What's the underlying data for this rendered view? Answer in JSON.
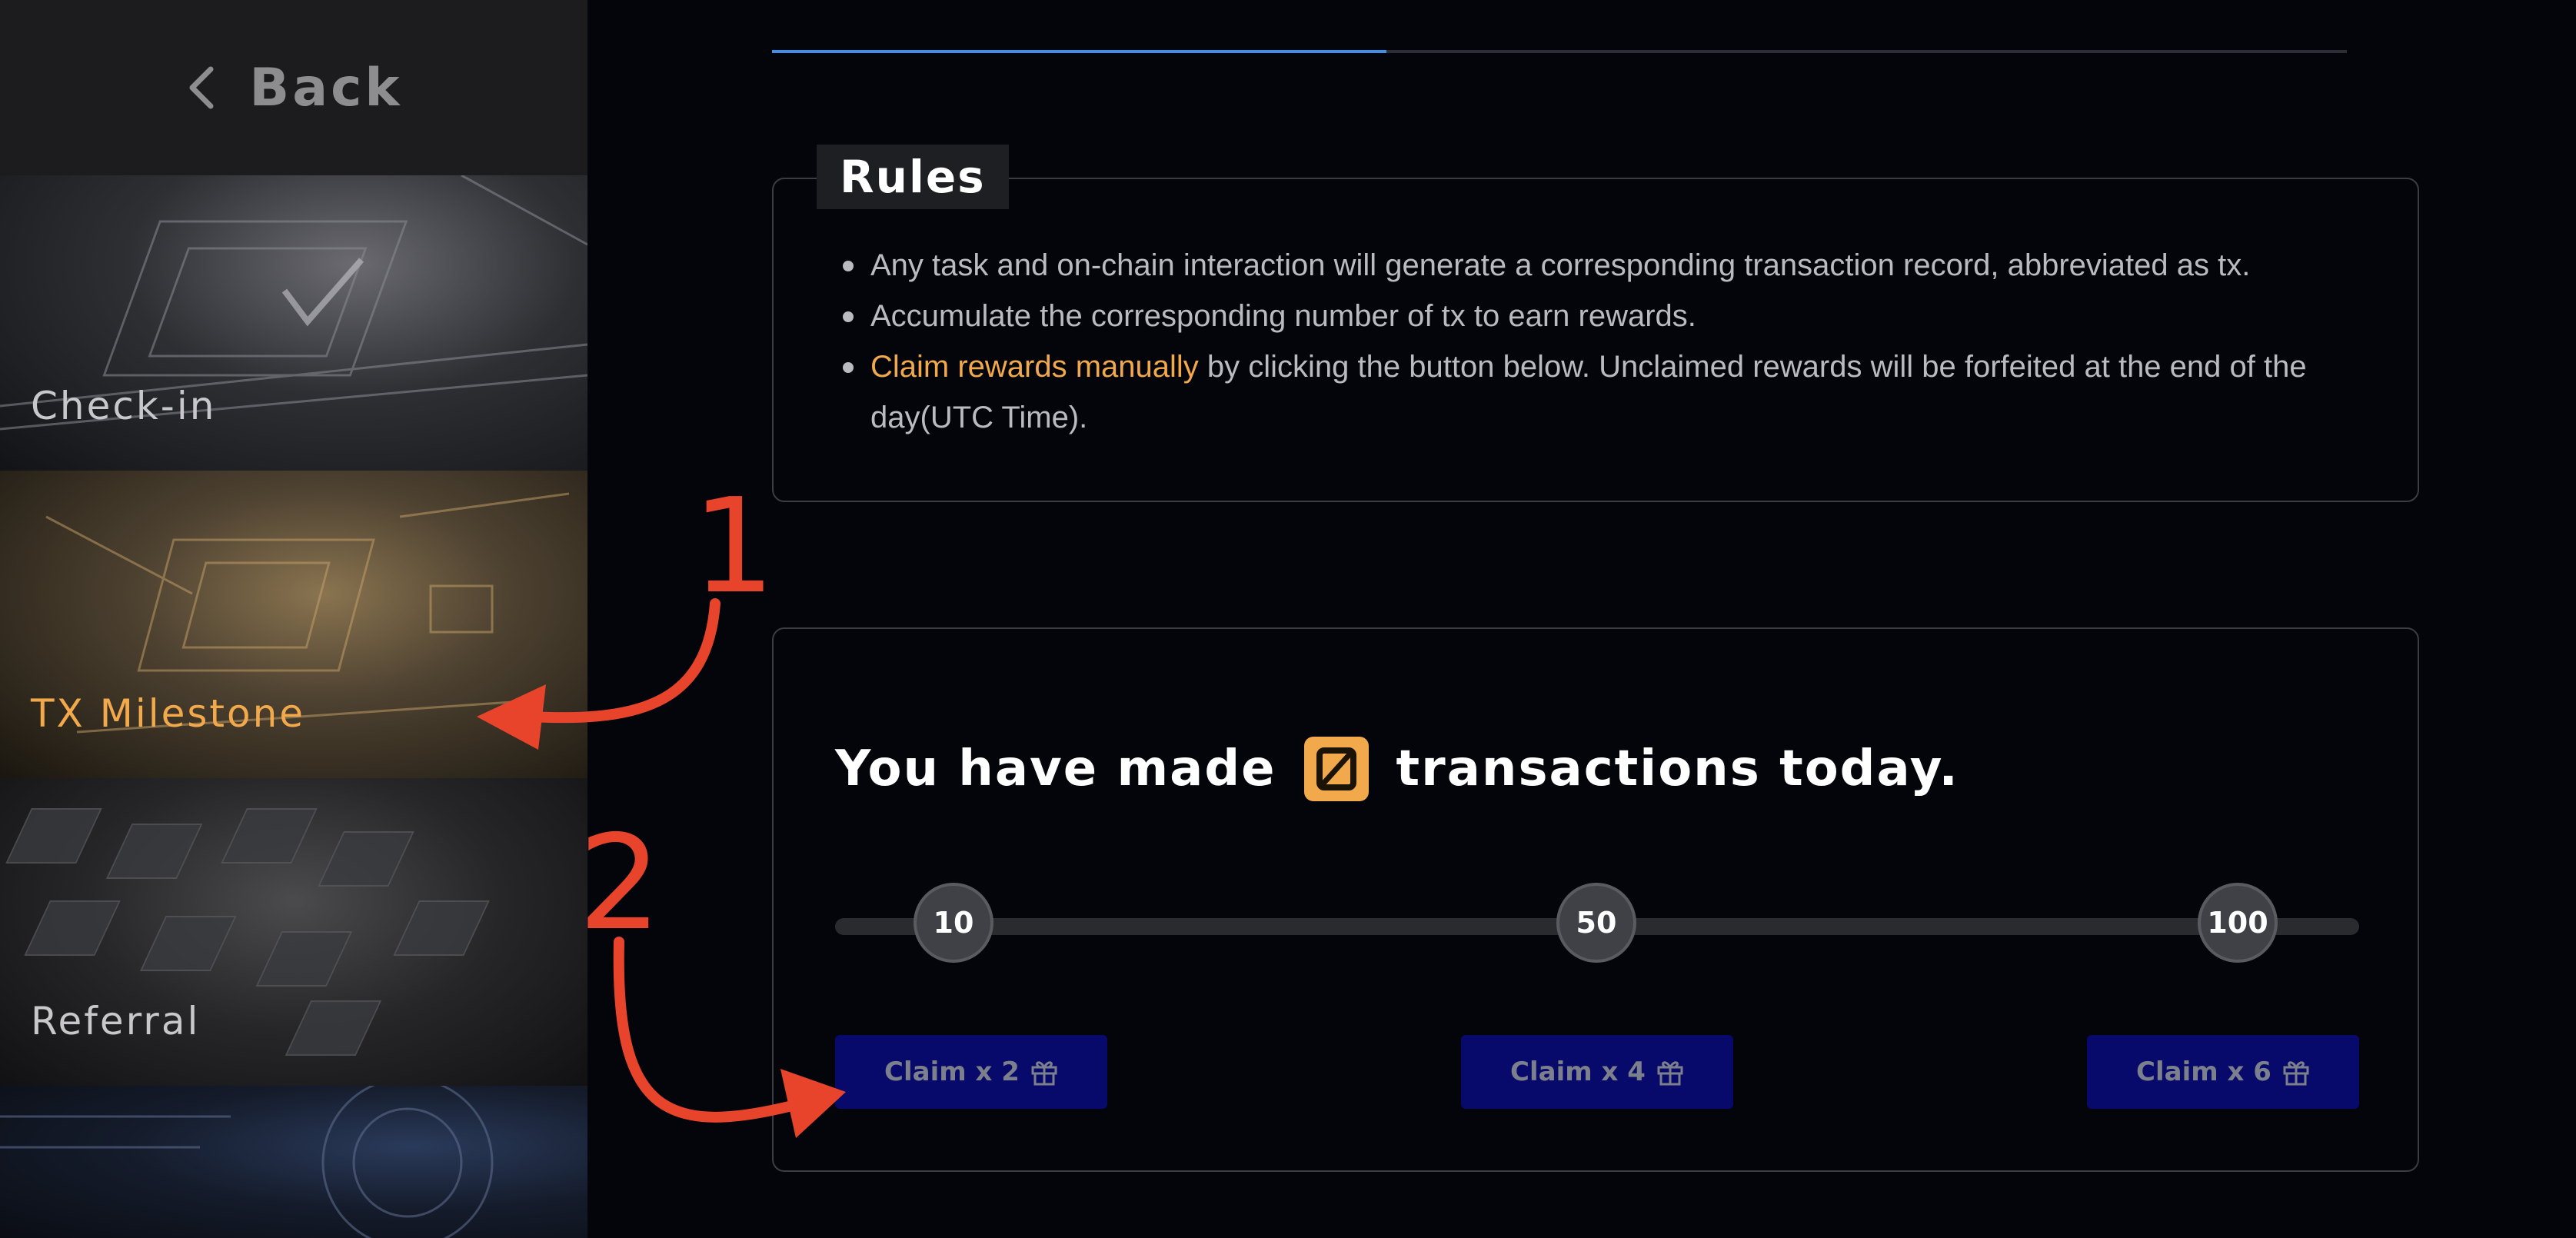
{
  "sidebar": {
    "back_label": "Back",
    "items": [
      {
        "label": "Check-in"
      },
      {
        "label": "TX Milestone"
      },
      {
        "label": "Referral"
      }
    ]
  },
  "progress": {
    "fraction": 0.39
  },
  "rules": {
    "title": "Rules",
    "items": [
      "Any task and on-chain interaction will generate a corresponding transaction record, abbreviated as tx.",
      "Accumulate the corresponding number of tx to earn rewards."
    ],
    "item3_highlight": "Claim rewards manually",
    "item3_rest": " by clicking the button below. Unclaimed rewards will be forfeited at the end of the day(UTC Time)."
  },
  "milestone": {
    "heading_prefix": "You have made",
    "count": "0",
    "heading_suffix": "transactions today.",
    "marks": [
      {
        "label": "10"
      },
      {
        "label": "50"
      },
      {
        "label": "100"
      }
    ],
    "claims": [
      {
        "label": "Claim x 2"
      },
      {
        "label": "Claim x 4"
      },
      {
        "label": "Claim x 6"
      }
    ]
  },
  "annotations": [
    "1",
    "2"
  ],
  "colors": {
    "accent": "#f2a94b",
    "progress": "#3d8fe8",
    "claim_button": "#070a6a",
    "annotation": "#e8442b"
  }
}
